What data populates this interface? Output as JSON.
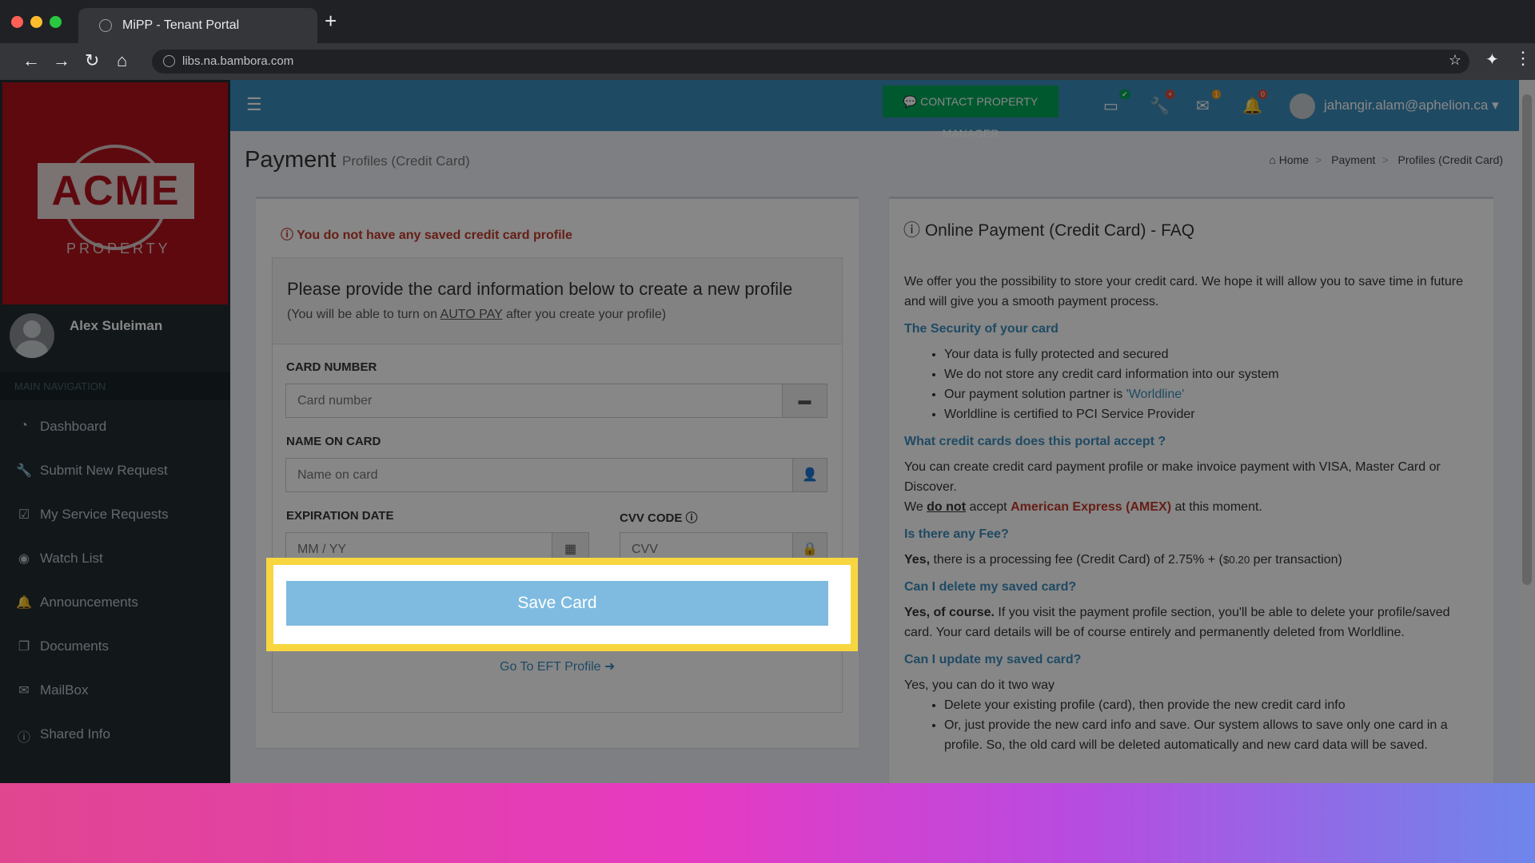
{
  "browser": {
    "tab_title": "MiPP - Tenant Portal",
    "url": "libs.na.bambora.com",
    "new_tab": "+",
    "back": "←",
    "forward": "→",
    "reload": "↻",
    "home": "⌂",
    "star": "☆",
    "extensions": "✦",
    "menu": "⋮"
  },
  "sidebar": {
    "logo_text": "ACME",
    "logo_sub": "PROPERTY",
    "user_name": "Alex Suleiman",
    "nav_header": "MAIN NAVIGATION",
    "items": [
      {
        "label": "Dashboard",
        "icon": "dashboard-icon"
      },
      {
        "label": "Submit New Request",
        "icon": "wrench-icon"
      },
      {
        "label": "My Service Requests",
        "icon": "check-square-icon"
      },
      {
        "label": "Watch List",
        "icon": "eye-icon"
      },
      {
        "label": "Announcements",
        "icon": "bell-icon"
      },
      {
        "label": "Documents",
        "icon": "copy-icon"
      },
      {
        "label": "MailBox",
        "icon": "envelope-icon"
      },
      {
        "label": "Shared Info",
        "icon": "info-icon"
      }
    ]
  },
  "header": {
    "contact_button": "CONTACT PROPERTY MANAGER",
    "badges": {
      "card": "✔",
      "wrench": "+",
      "mail": "1",
      "bell": "0"
    },
    "user_email": "jahangir.alam@aphelion.ca"
  },
  "page": {
    "title": "Payment",
    "subtitle": "Profiles (Credit Card)",
    "breadcrumb": [
      "Home",
      "Payment",
      "Profiles (Credit Card)"
    ]
  },
  "form": {
    "alert": "You do not have any saved credit card profile",
    "heading": "Please provide the card information below to create a new profile",
    "note_prefix": "(You will be able to turn on ",
    "note_link": "AUTO PAY",
    "note_suffix": " after you create your profile)",
    "card_number_label": "CARD NUMBER",
    "card_number_placeholder": "Card number",
    "name_label": "NAME ON CARD",
    "name_placeholder": "Name on card",
    "expiry_label": "EXPIRATION DATE",
    "expiry_placeholder": "MM / YY",
    "cvv_label": "CVV CODE",
    "cvv_placeholder": "CVV",
    "save_button": "Save Card",
    "eft_link": "Go To EFT Profile"
  },
  "faq": {
    "title": "Online Payment (Credit Card) - FAQ",
    "intro": "We offer you the possibility to store your credit card. We hope it will allow you to save time in future and will give you a smooth payment process.",
    "q1": "The Security of your card",
    "q1_items": [
      "Your data is fully protected and secured",
      "We do not store any credit card information into our system",
      "Our payment solution partner is ",
      "Worldline is certified to PCI Service Provider"
    ],
    "q1_partner": "'Worldline'",
    "q2": "What credit cards does this portal accept ?",
    "a2": "You can create credit card payment profile or make invoice payment with VISA, Master Card or Discover.",
    "a2b_prefix": "We ",
    "a2b_bold": "do not",
    "a2b_mid": " accept ",
    "a2b_red": "American Express (AMEX)",
    "a2b_suffix": " at this moment.",
    "q3": "Is there any Fee?",
    "a3_bold": "Yes,",
    "a3": " there is a processing fee (Credit Card) of 2.75% + (",
    "a3_small": "$0.20",
    "a3_end": " per transaction)",
    "q4": "Can I delete my saved card?",
    "a4_bold": "Yes, of course.",
    "a4": " If you visit the payment profile section, you'll be able to delete your profile/saved card. Your card details will be of course entirely and permanently deleted from Worldline.",
    "q5": "Can I update my saved card?",
    "a5": "Yes, you can do it two way",
    "a5_items": [
      "Delete your existing profile (card), then provide the new credit card info",
      "Or, just provide the new card info and save. Our system allows to save only one card in a profile. So, the old card will be deleted automatically and new card data will be saved."
    ]
  },
  "colors": {
    "header_blue": "#3c8dbc",
    "sidebar_dark": "#222d32",
    "logo_red": "#b1121c",
    "contact_green": "#00a65a",
    "highlight_yellow": "#f8d640",
    "save_button_blue": "#7fbbe0"
  }
}
